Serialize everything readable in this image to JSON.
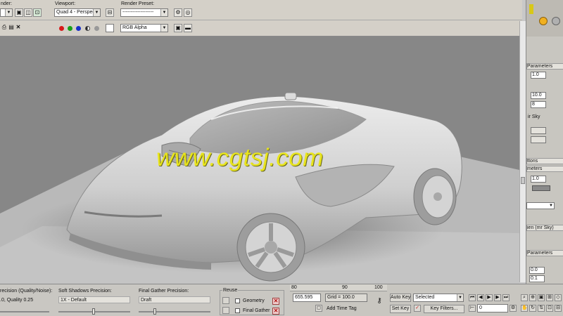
{
  "toolbar": {
    "area_label": "nder:",
    "viewport_label": "Viewport:",
    "viewport_value": "Quad 4 - Perspec",
    "preset_label": "Render Preset:",
    "preset_value": "-------------------",
    "channel_value": "RGB Alpha"
  },
  "viewport": {
    "watermark": "www.cgtsj.com"
  },
  "render_panel": {
    "precision_label": "recision (Quality/Noise):",
    "precision_value": ".0, Quality 0.25",
    "shadows_label": "Soft Shadows Precision:",
    "shadows_value": "1X - Default",
    "fg_label": "Final Gather Precision:",
    "fg_value": "Draft",
    "reuse_label": "Reuse",
    "geometry_label": "Geometry",
    "final_gather_label": "Final Gather"
  },
  "timeline": {
    "ticks": [
      "80",
      "90",
      "100"
    ],
    "coord_value": "655.595",
    "grid_label": "Grid = 100.0",
    "add_time_tag": "Add Time Tag",
    "auto_key": "Auto Key",
    "selected": "Selected",
    "set_key": "Set Key",
    "key_filters": "Key Filters...",
    "frame_value": "0"
  },
  "command_panel": {
    "rollout_params": "Parameters",
    "spin_1": "1.0",
    "spin_2": "10.0",
    "spin_3": "8",
    "sky_label": "ir Sky",
    "rollout_buttons": "ttons",
    "rollout_meters": "meters",
    "spin_4": "1.0",
    "rollout_mrsky": "ien (mr Sky)",
    "rollout_params2": "Parameters",
    "spin_5": "0.0",
    "spin_6": "0.1"
  }
}
